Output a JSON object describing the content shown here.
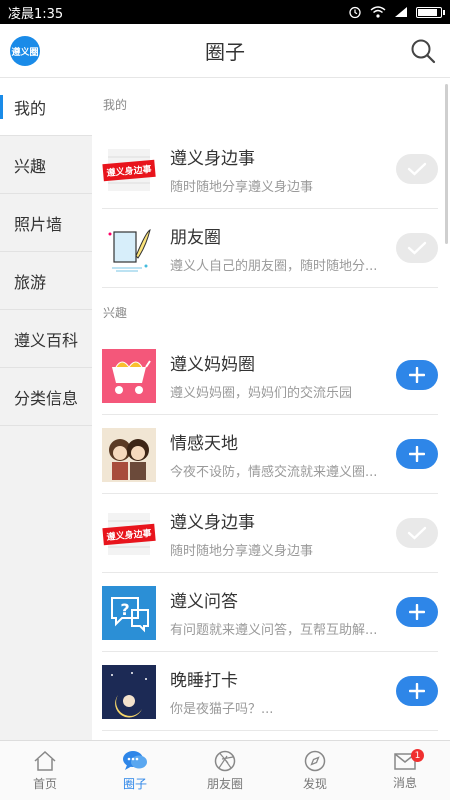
{
  "status_bar": {
    "time": "凌晨1:35"
  },
  "header": {
    "title": "圈子",
    "logo_text": "遵义圈"
  },
  "sidebar": {
    "items": [
      {
        "label": "我的",
        "active": true
      },
      {
        "label": "兴趣"
      },
      {
        "label": "照片墙"
      },
      {
        "label": "旅游"
      },
      {
        "label": "遵义百科"
      },
      {
        "label": "分类信息"
      }
    ]
  },
  "sections": [
    {
      "title": "我的",
      "items": [
        {
          "name": "遵义身边事",
          "desc": "随时随地分享遵义身边事",
          "joined": true,
          "icon": "red-banner-icon",
          "banner_text": "遵义身边事"
        },
        {
          "name": "朋友圈",
          "desc": "遵义人自己的朋友圈，随时随地分...",
          "joined": true,
          "icon": "feather-paper-icon"
        }
      ]
    },
    {
      "title": "兴趣",
      "items": [
        {
          "name": "遵义妈妈圈",
          "desc": "遵义妈妈圈，妈妈们的交流乐园",
          "joined": false,
          "icon": "stroller-icon"
        },
        {
          "name": "情感天地",
          "desc": "今夜不设防，情感交流就来遵义圈...",
          "joined": false,
          "icon": "couple-icon"
        },
        {
          "name": "遵义身边事",
          "desc": "随时随地分享遵义身边事",
          "joined": true,
          "icon": "red-banner-icon",
          "banner_text": "遵义身边事"
        },
        {
          "name": "遵义问答",
          "desc": "有问题就来遵义问答，互帮互助解...",
          "joined": false,
          "icon": "question-bubble-icon"
        },
        {
          "name": "晚睡打卡",
          "desc": "你是夜猫子吗？...",
          "joined": false,
          "icon": "moon-night-icon"
        }
      ]
    }
  ],
  "tabbar": {
    "tabs": [
      {
        "label": "首页",
        "icon": "home-icon"
      },
      {
        "label": "圈子",
        "icon": "chat-bubbles-icon",
        "active": true
      },
      {
        "label": "朋友圈",
        "icon": "aperture-icon"
      },
      {
        "label": "发现",
        "icon": "compass-icon"
      },
      {
        "label": "消息",
        "icon": "mail-icon",
        "badge": "1"
      }
    ]
  },
  "colors": {
    "accent": "#2e86e8",
    "badge": "#f03030"
  }
}
